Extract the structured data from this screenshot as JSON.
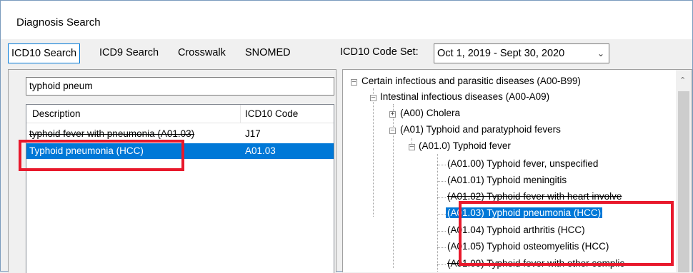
{
  "window": {
    "title": "Diagnosis Search"
  },
  "tabs": [
    {
      "label": "ICD10 Search"
    },
    {
      "label": "ICD9 Search"
    },
    {
      "label": "Crosswalk"
    },
    {
      "label": "SNOMED"
    }
  ],
  "codeset": {
    "label": "ICD10 Code Set:",
    "value": "Oct 1, 2019 - Sept 30, 2020"
  },
  "search": {
    "value": "typhoid pneum"
  },
  "results": {
    "columns": [
      "Description",
      "ICD10 Code"
    ],
    "rows": [
      {
        "description": "typhoid fever with pneumonia (A01.03)",
        "code": "J17"
      },
      {
        "description": "Typhoid pneumonia (HCC)",
        "code": "A01.03"
      }
    ]
  },
  "tree": {
    "root": "Certain infectious and parasitic diseases (A00-B99)",
    "group": "Intestinal infectious diseases (A00-A09)",
    "cholera": "(A00) Cholera",
    "typhoid": "(A01) Typhoid and paratyphoid fevers",
    "typhoid_fever": "(A01.0) Typhoid fever",
    "leaves": [
      "(A01.00) Typhoid fever, unspecified",
      "(A01.01) Typhoid meningitis",
      "(A01.02) Typhoid fever with heart involve",
      "(A01.03) Typhoid pneumonia (HCC)",
      "(A01.04) Typhoid arthritis (HCC)",
      "(A01.05) Typhoid osteomyelitis (HCC)",
      "(A01.09) Typhoid fever with other complic"
    ]
  },
  "colors": {
    "selection": "#0078d7",
    "highlight": "#e8192c"
  }
}
